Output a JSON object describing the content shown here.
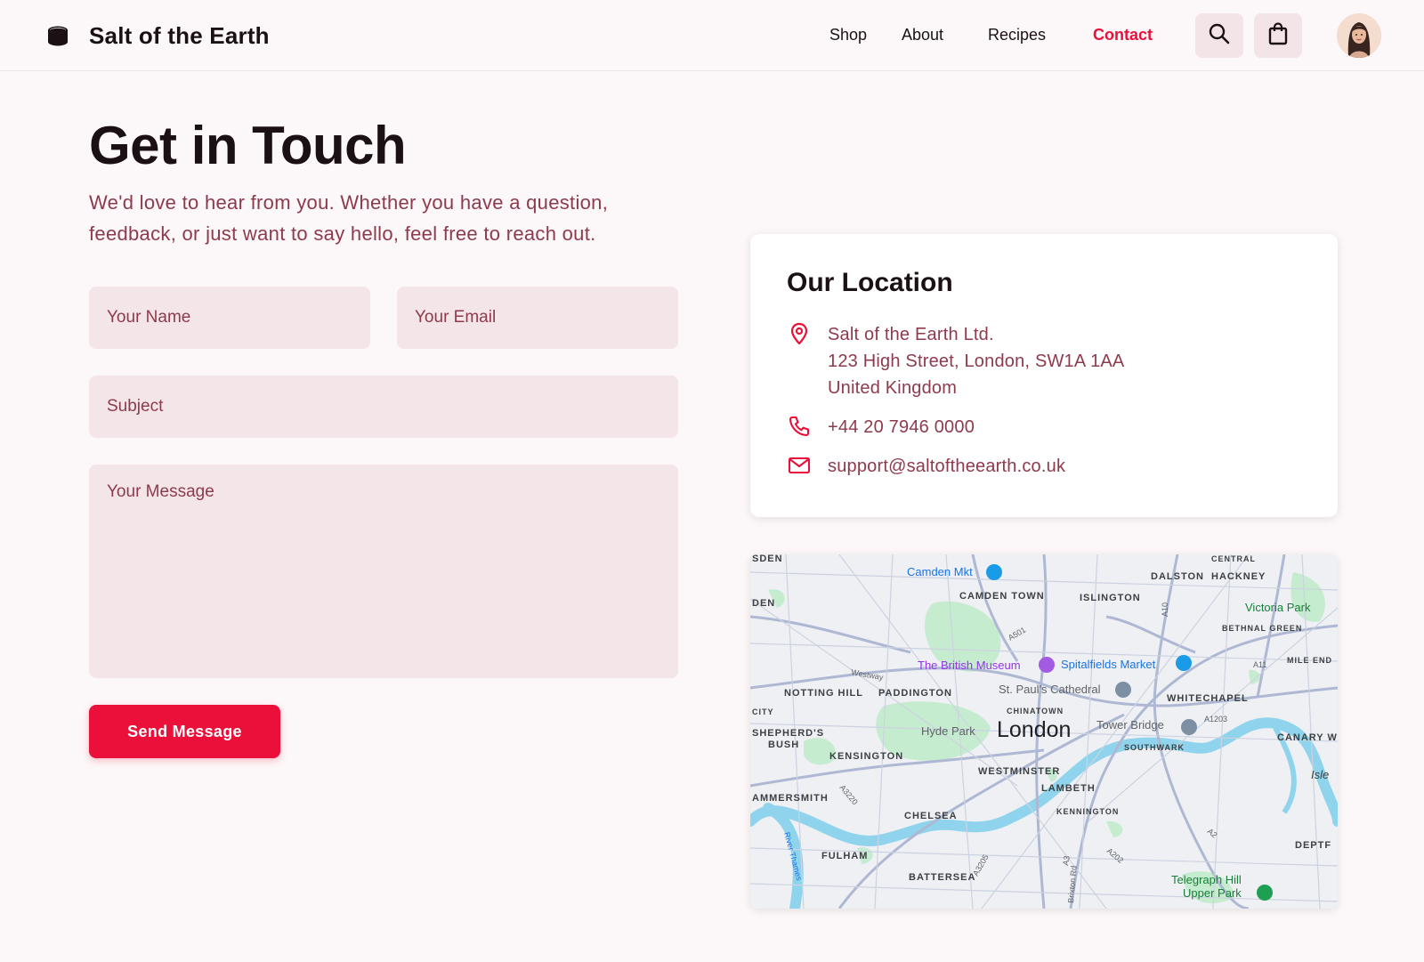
{
  "brand": {
    "name": "Salt of the Earth",
    "logo_icon": "salt-cellar-icon"
  },
  "nav": {
    "items": [
      {
        "label": "Shop",
        "active": false
      },
      {
        "label": "About",
        "active": false
      },
      {
        "label": "Recipes",
        "active": false
      },
      {
        "label": "Contact",
        "active": true
      }
    ],
    "search_icon": "search-icon",
    "cart_icon": "shopping-bag-icon"
  },
  "page": {
    "title": "Get in Touch",
    "subtitle": "We'd love to hear from you. Whether you have a question, feedback, or just want to say hello, feel free to reach out."
  },
  "form": {
    "name_placeholder": "Your Name",
    "email_placeholder": "Your Email",
    "subject_placeholder": "Subject",
    "message_placeholder": "Your Message",
    "submit_label": "Send Message"
  },
  "location": {
    "title": "Our Location",
    "address_line1": "Salt of the Earth Ltd.",
    "address_line2": "123 High Street, London, SW1A 1AA",
    "address_line3": "United Kingdom",
    "phone": "+44 20 7946 0000",
    "email": "support@saltoftheearth.co.uk"
  },
  "map": {
    "city": "London",
    "labels": [
      "SDEN",
      "Camden Mkt",
      "CENTRAL",
      "DALSTON",
      "HACKNEY",
      "DEN",
      "CAMDEN TOWN",
      "ISLINGTON",
      "Victoria Park",
      "BETHNAL GREEN",
      "MILE END",
      "The British Museum",
      "Spitalfields Market",
      "NOTTING HILL",
      "PADDINGTON",
      "St. Paul's Cathedral",
      "WHITECHAPEL",
      "CHINATOWN",
      "CITY",
      "SHEPHERD'S",
      "BUSH",
      "Hyde Park",
      "Tower Bridge",
      "SOUTHWARK",
      "CANARY W",
      "KENSINGTON",
      "WESTMINSTER",
      "LAMBETH",
      "Isle",
      "AMMERSMITH",
      "CHELSEA",
      "KENNINGTON",
      "DEPTF",
      "FULHAM",
      "BATTERSEA",
      "Telegraph Hill",
      "Upper Park",
      "Westway",
      "A501",
      "A10",
      "A11",
      "A1203",
      "A3220",
      "A3205",
      "A3",
      "A202",
      "A2",
      "River Thames",
      "Brixton Rd"
    ]
  }
}
